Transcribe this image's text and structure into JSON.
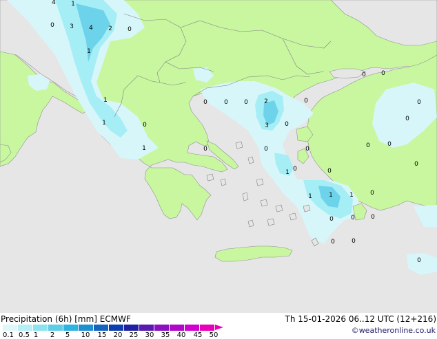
{
  "header": {
    "title": "Precipitation (6h) [mm] ECMWF",
    "validity": "Th 15-01-2026 06..12 UTC (12+216)",
    "credit": "©weatheronline.co.uk"
  },
  "colors": {
    "sea": "#e6e6e6",
    "land": "#c8f7a0",
    "coast": "#909090",
    "rain_light": "#d7f6fa",
    "rain_medium": "#a6eef5",
    "rain_heavy": "#6dd3ea",
    "rain_strong": "#3fb5e0"
  },
  "legend": {
    "tick_labels": [
      "0.1",
      "0.5",
      "1",
      "2",
      "5",
      "10",
      "15",
      "20",
      "25",
      "30",
      "35",
      "40",
      "45",
      "50"
    ],
    "colors": [
      "#e0f7f9",
      "#b5eef4",
      "#8ce2ef",
      "#5fcde8",
      "#2fb3df",
      "#1f8fd0",
      "#1565c0",
      "#0d3fb0",
      "#2020a0",
      "#5a1ab0",
      "#8a10c0",
      "#b008c8",
      "#d000d0",
      "#e800b8"
    ]
  },
  "map": {
    "value_labels": [
      {
        "text": "4"
      },
      {
        "text": "1"
      },
      {
        "text": "0"
      },
      {
        "text": "3"
      },
      {
        "text": "4"
      },
      {
        "text": "2"
      },
      {
        "text": "0"
      },
      {
        "text": "1"
      },
      {
        "text": "0"
      },
      {
        "text": "0"
      },
      {
        "text": "1"
      },
      {
        "text": "1"
      },
      {
        "text": "0"
      },
      {
        "text": "1"
      },
      {
        "text": "0"
      },
      {
        "text": "0"
      },
      {
        "text": "0"
      },
      {
        "text": "0"
      },
      {
        "text": "2"
      },
      {
        "text": "0"
      },
      {
        "text": "3"
      },
      {
        "text": "0"
      },
      {
        "text": "0"
      },
      {
        "text": "0"
      },
      {
        "text": "0"
      },
      {
        "text": "0"
      },
      {
        "text": "0"
      },
      {
        "text": "0"
      },
      {
        "text": "1"
      },
      {
        "text": "0"
      },
      {
        "text": "1"
      },
      {
        "text": "1"
      },
      {
        "text": "1"
      },
      {
        "text": "0"
      },
      {
        "text": "0"
      },
      {
        "text": "0"
      },
      {
        "text": "0"
      },
      {
        "text": "0"
      },
      {
        "text": "0"
      },
      {
        "text": "0"
      },
      {
        "text": "0"
      },
      {
        "text": "0"
      }
    ]
  }
}
